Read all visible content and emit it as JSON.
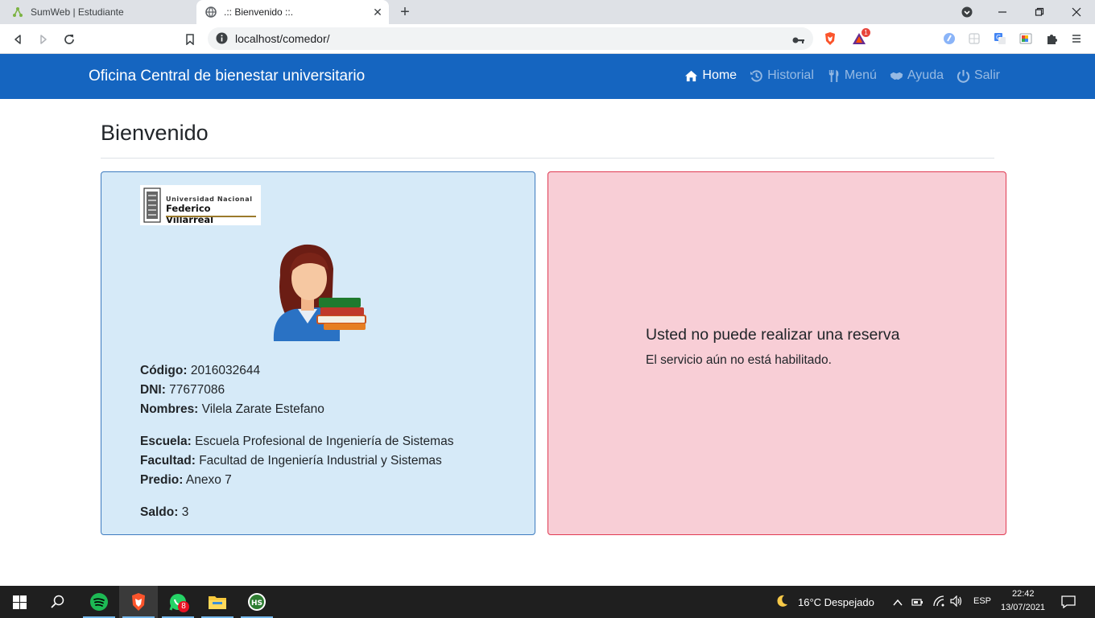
{
  "browser": {
    "tabs": [
      {
        "title": "SumWeb | Estudiante",
        "active": false
      },
      {
        "title": ".:: Bienvenido ::.",
        "active": true
      }
    ],
    "url": "localhost/comedor/",
    "brave_badge": "1"
  },
  "navbar": {
    "brand": "Oficina Central de bienestar universitario",
    "links": [
      {
        "label": "Home",
        "icon": "home-icon",
        "active": true
      },
      {
        "label": "Historial",
        "icon": "history-icon",
        "active": false
      },
      {
        "label": "Menú",
        "icon": "utensils-icon",
        "active": false
      },
      {
        "label": "Ayuda",
        "icon": "handshake-icon",
        "active": false
      },
      {
        "label": "Salir",
        "icon": "power-icon",
        "active": false
      }
    ]
  },
  "page": {
    "title": "Bienvenido"
  },
  "logo": {
    "line1": "Universidad Nacional",
    "line2": "Federico Villarreal"
  },
  "student": {
    "codigo_label": "Código:",
    "codigo": "2016032644",
    "dni_label": "DNI:",
    "dni": "77677086",
    "nombres_label": "Nombres:",
    "nombres": "Vilela Zarate Estefano",
    "escuela_label": "Escuela:",
    "escuela": "Escuela Profesional de Ingeniería de Sistemas",
    "facultad_label": "Facultad:",
    "facultad": "Facultad de Ingeniería Industrial y Sistemas",
    "predio_label": "Predio:",
    "predio": "Anexo 7",
    "saldo_label": "Saldo:",
    "saldo": "3"
  },
  "alert": {
    "title": "Usted no puede realizar una reserva",
    "message": "El servicio aún no está habilitado."
  },
  "taskbar": {
    "whatsapp_badge": "8",
    "weather": "16°C  Despejado",
    "language": "ESP",
    "time": "22:42",
    "date": "13/07/2021"
  },
  "colors": {
    "navbar": "#1565c0",
    "student_card_bg": "#d6eaf8",
    "student_card_border": "#3d7bbf",
    "alert_card_bg": "#f8ced6",
    "alert_card_border": "#e03a52"
  }
}
